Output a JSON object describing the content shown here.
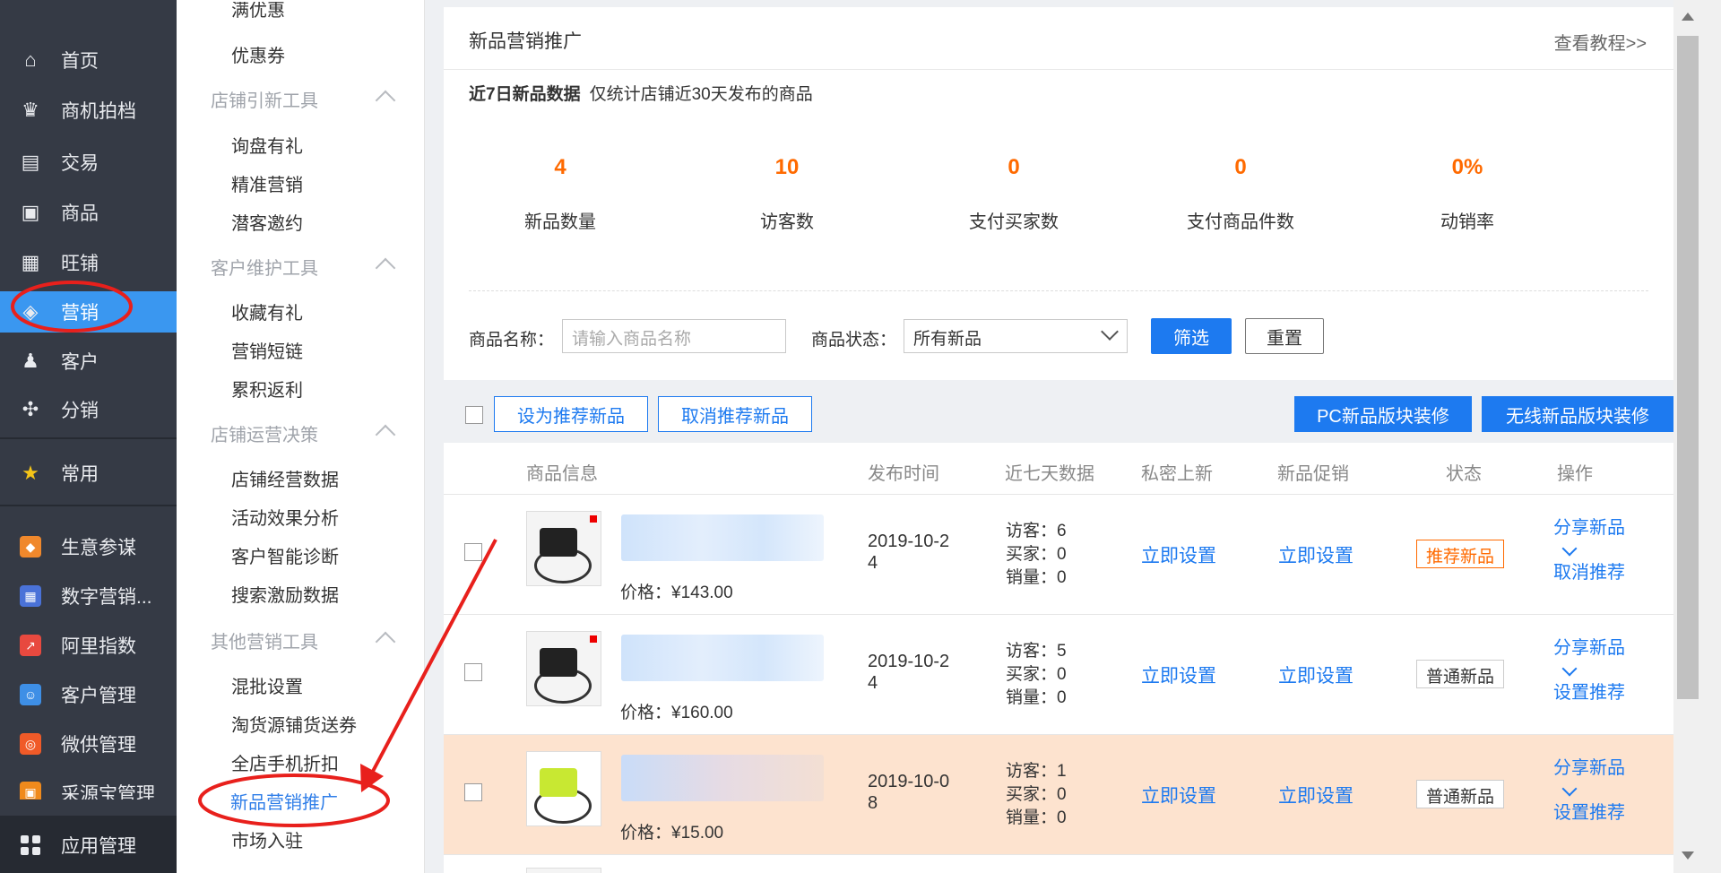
{
  "nav": {
    "items": [
      {
        "label": "首页",
        "icon": "home-icon",
        "glyph": "⌂"
      },
      {
        "label": "商机拍档",
        "icon": "crown-icon",
        "glyph": "♛"
      },
      {
        "label": "交易",
        "icon": "clipboard-icon",
        "glyph": "▤"
      },
      {
        "label": "商品",
        "icon": "box-icon",
        "glyph": "▣"
      },
      {
        "label": "旺铺",
        "icon": "store-icon",
        "glyph": "▦"
      },
      {
        "label": "营销",
        "icon": "tag-icon",
        "glyph": "◈"
      },
      {
        "label": "客户",
        "icon": "user-icon",
        "glyph": "♟"
      },
      {
        "label": "分销",
        "icon": "share-icon",
        "glyph": "✣"
      }
    ],
    "favorite": {
      "label": "常用",
      "icon": "star-icon",
      "glyph": "★"
    },
    "apps": [
      {
        "label": "生意参谋",
        "icon": "compass-icon",
        "color": "#f0882c"
      },
      {
        "label": "数字营销...",
        "icon": "chart-board-icon",
        "color": "#4a72d8"
      },
      {
        "label": "阿里指数",
        "icon": "trend-icon",
        "color": "#e8493f"
      },
      {
        "label": "客户管理",
        "icon": "customer-icon",
        "color": "#3e8fe6"
      },
      {
        "label": "微供管理",
        "icon": "supply-icon",
        "color": "#f05a28"
      },
      {
        "label": "采源宝管理",
        "icon": "source-icon",
        "color": "#f08a1c"
      }
    ],
    "bottom": {
      "label": "应用管理",
      "icon": "grid-icon"
    }
  },
  "subnav": {
    "top_item": "满优惠",
    "coupon": "优惠券",
    "groups": [
      {
        "title": "店铺引新工具",
        "items": [
          "询盘有礼",
          "精准营销",
          "潜客邀约"
        ]
      },
      {
        "title": "客户维护工具",
        "items": [
          "收藏有礼",
          "营销短链",
          "累积返利"
        ]
      },
      {
        "title": "店铺运营决策",
        "items": [
          "店铺经营数据",
          "活动效果分析",
          "客户智能诊断",
          "搜索激励数据"
        ]
      },
      {
        "title": "其他营销工具",
        "items": [
          "混批设置",
          "淘货源铺货送券",
          "全店手机折扣",
          "新品营销推广",
          "市场入驻"
        ]
      }
    ]
  },
  "page": {
    "title": "新品营销推广",
    "tutorial": "查看教程>>",
    "stats_title": "近7日新品数据",
    "stats_note": "仅统计店铺近30天发布的商品",
    "stats": [
      {
        "value": "4",
        "label": "新品数量"
      },
      {
        "value": "10",
        "label": "访客数"
      },
      {
        "value": "0",
        "label": "支付买家数"
      },
      {
        "value": "0",
        "label": "支付商品件数"
      },
      {
        "value": "0%",
        "label": "动销率"
      }
    ],
    "filter": {
      "name_label": "商品名称：",
      "name_placeholder": "请输入商品名称",
      "status_label": "商品状态：",
      "status_value": "所有新品",
      "filter_btn": "筛选",
      "reset_btn": "重置"
    },
    "toolbar": {
      "set_rec": "设为推荐新品",
      "cancel_rec": "取消推荐新品",
      "pc_decor": "PC新品版块装修",
      "wireless_decor": "无线新品版块装修"
    },
    "table": {
      "headers": [
        "商品信息",
        "发布时间",
        "近七天数据",
        "私密上新",
        "新品促销",
        "状态",
        "操作"
      ],
      "rows": [
        {
          "price": "价格：¥143.00",
          "date_line1": "2019-10-2",
          "date_line2": "4",
          "visitors": "访客：6",
          "buyers": "买家：0",
          "sales": "销量：0",
          "private": "立即设置",
          "promo": "立即设置",
          "status": "推荐新品",
          "op1": "分享新品",
          "op2": "取消推荐"
        },
        {
          "price": "价格：¥160.00",
          "date_line1": "2019-10-2",
          "date_line2": "4",
          "visitors": "访客：5",
          "buyers": "买家：0",
          "sales": "销量：0",
          "private": "立即设置",
          "promo": "立即设置",
          "status": "普通新品",
          "op1": "分享新品",
          "op2": "设置推荐"
        },
        {
          "price": "价格：¥15.00",
          "date_line1": "2019-10-0",
          "date_line2": "8",
          "visitors": "访客：1",
          "buyers": "买家：0",
          "sales": "销量：0",
          "private": "立即设置",
          "promo": "立即设置",
          "status": "普通新品",
          "op1": "分享新品",
          "op2": "设置推荐"
        }
      ]
    }
  },
  "colors": {
    "accent": "#1d7af0",
    "nav_bg": "#353a45",
    "active_nav": "#3a97f0",
    "orange": "#ff6a00",
    "annotation": "#e8201c"
  }
}
